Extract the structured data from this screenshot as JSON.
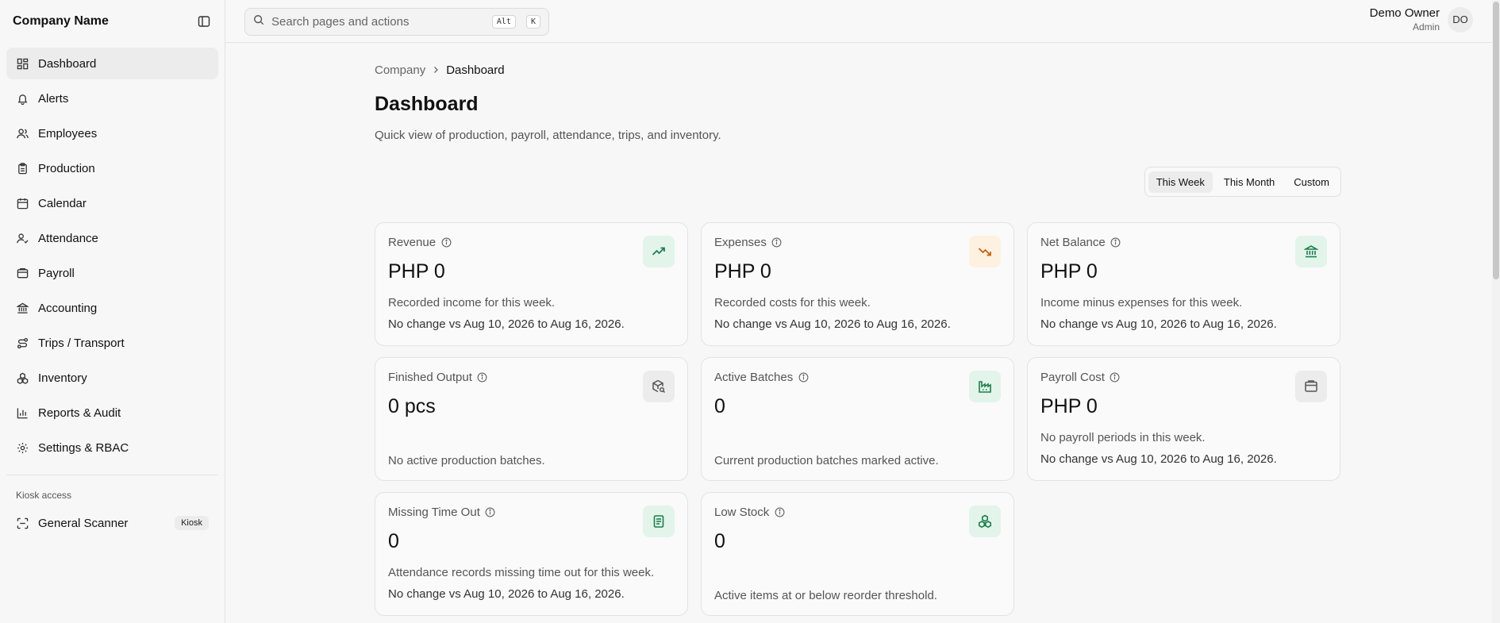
{
  "sidebar": {
    "company_name": "Company Name",
    "items": [
      {
        "label": "Dashboard"
      },
      {
        "label": "Alerts"
      },
      {
        "label": "Employees"
      },
      {
        "label": "Production"
      },
      {
        "label": "Calendar"
      },
      {
        "label": "Attendance"
      },
      {
        "label": "Payroll"
      },
      {
        "label": "Accounting"
      },
      {
        "label": "Trips / Transport"
      },
      {
        "label": "Inventory"
      },
      {
        "label": "Reports & Audit"
      },
      {
        "label": "Settings & RBAC"
      }
    ],
    "kiosk_section_label": "Kiosk access",
    "kiosk_item": {
      "label": "General Scanner",
      "badge": "Kiosk"
    }
  },
  "topbar": {
    "search_placeholder": "Search pages and actions",
    "shortcut_keys": [
      "Alt",
      "K"
    ],
    "user": {
      "name": "Demo Owner",
      "role": "Admin",
      "initials": "DO"
    }
  },
  "page": {
    "breadcrumb": [
      "Company",
      "Dashboard"
    ],
    "title": "Dashboard",
    "subtitle": "Quick view of production, payroll, attendance, trips, and inventory.",
    "range_options": [
      "This Week",
      "This Month",
      "Custom"
    ],
    "active_range": "This Week"
  },
  "cards": [
    {
      "title": "Revenue",
      "value": "PHP 0",
      "desc": "Recorded income for this week.",
      "change": "No change vs Aug 10, 2026 to Aug 16, 2026.",
      "icon": "trending-up-icon",
      "accent": "#1a7f4b"
    },
    {
      "title": "Expenses",
      "value": "PHP 0",
      "desc": "Recorded costs for this week.",
      "change": "No change vs Aug 10, 2026 to Aug 16, 2026.",
      "icon": "trending-down-icon",
      "accent": "#c8620a"
    },
    {
      "title": "Net Balance",
      "value": "PHP 0",
      "desc": "Income minus expenses for this week.",
      "change": "No change vs Aug 10, 2026 to Aug 16, 2026.",
      "icon": "bank-icon",
      "accent": "#1a7f4b"
    },
    {
      "title": "Finished Output",
      "value": "0 pcs",
      "desc": "No active production batches.",
      "icon": "package-search-icon",
      "accent": "#555555"
    },
    {
      "title": "Active Batches",
      "value": "0",
      "desc": "Current production batches marked active.",
      "icon": "factory-icon",
      "accent": "#1a7f4b"
    },
    {
      "title": "Payroll Cost",
      "value": "PHP 0",
      "desc": "No payroll periods in this week.",
      "change": "No change vs Aug 10, 2026 to Aug 16, 2026.",
      "icon": "wallet-icon",
      "accent": "#555555"
    },
    {
      "title": "Missing Time Out",
      "value": "0",
      "desc": "Attendance records missing time out for this week.",
      "change": "No change vs Aug 10, 2026 to Aug 16, 2026.",
      "icon": "clipboard-icon",
      "accent": "#1a7f4b"
    },
    {
      "title": "Low Stock",
      "value": "0",
      "desc": "Active items at or below reorder threshold.",
      "icon": "boxes-icon",
      "accent": "#1a7f4b"
    }
  ]
}
